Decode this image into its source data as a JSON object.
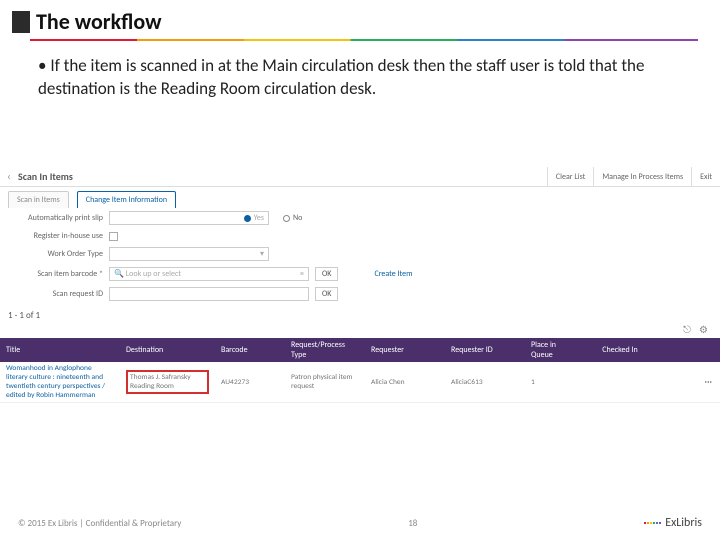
{
  "title": "The workflow",
  "bullet": "If the item is scanned in at the Main circulation desk then the staff user is told that the destination is the Reading Room circulation desk.",
  "screenshot": {
    "header": {
      "title": "Scan In Items",
      "actions": [
        "Clear List",
        "Manage In Process Items",
        "Exit"
      ]
    },
    "tabs": [
      "Scan in Items",
      "Change Item Information"
    ],
    "printslip": {
      "label": "Automatically print slip",
      "yes": "Yes",
      "no": "No"
    },
    "inhouse": {
      "label": "Register in-house use"
    },
    "workorder": {
      "label": "Work Order Type"
    },
    "barcode": {
      "label": "Scan item barcode *",
      "placeholder": "Look up or select",
      "ok": "OK",
      "create": "Create Item"
    },
    "request": {
      "label": "Scan request ID",
      "ok": "OK"
    },
    "count": "1 - 1 of 1",
    "cols": [
      "Title",
      "Destination",
      "Barcode",
      "Request/Process Type",
      "Requester",
      "Requester ID",
      "Place in Queue",
      "Checked In"
    ],
    "row": {
      "title": "Womanhood in Anglophone literary culture : nineteenth and twentieth century perspectives / edited by Robin Hammerman",
      "dest": "Thomas J. Safransky Reading Room",
      "barcode": "AU42273",
      "rptype": "Patron physical item request",
      "requester": "Alicia Chen",
      "reqid": "AliciaC613",
      "place": "1",
      "checked": ""
    }
  },
  "footer": {
    "left": "© 2015 Ex Libris | Confidential & Proprietary",
    "page": "18",
    "brand": "ExLibris"
  }
}
